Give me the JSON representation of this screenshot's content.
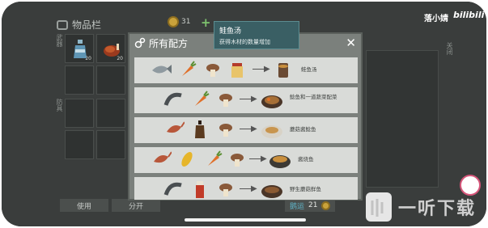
{
  "inventory": {
    "title": "物品栏",
    "coins": "31",
    "section_label": "武器",
    "section_label_2": "防具"
  },
  "inventory_items": [
    {
      "count": "20",
      "icon": "bottle-icon"
    },
    {
      "count": "20",
      "icon": "roast-chicken-icon"
    }
  ],
  "bottom_buttons": {
    "use": "使用",
    "split": "分开"
  },
  "right_panel": {
    "label": "关闭"
  },
  "stat": {
    "label": "鹅运",
    "value": "21"
  },
  "panel": {
    "title": "所有配方",
    "close": "✕"
  },
  "tooltip": {
    "title": "鲑鱼汤",
    "description": "获得木材的数量增加"
  },
  "recipes": [
    {
      "ingredients": [
        "fish-icon",
        "carrot-icon",
        "mushroom-icon",
        "jar-icon"
      ],
      "result_icon": "soup-bowl-icon",
      "name": "鲑鱼汤"
    },
    {
      "ingredients": [
        "eel-icon",
        "carrot-icon",
        "mushroom-icon"
      ],
      "result_icon": "stew-plate-icon",
      "name": "鲶鱼和一道蔬菜配菜"
    },
    {
      "ingredients": [
        "shrimp-icon",
        "bottle-icon",
        "mushroom-icon"
      ],
      "result_icon": "shrimp-plate-icon",
      "name": "蘑菇酱鲶鱼"
    },
    {
      "ingredients": [
        "shrimp-icon",
        "corn-icon",
        "carrot-icon",
        "mushroom-icon"
      ],
      "result_icon": "fish-plate-icon",
      "name": "酱烧鱼"
    },
    {
      "ingredients": [
        "eel-icon",
        "sauce-icon",
        "mushroom-icon"
      ],
      "result_icon": "grill-plate-icon",
      "name": "野生蘑菇鲜鱼"
    }
  ],
  "watermark": {
    "user": "落小婧",
    "brand": "bilibili",
    "logo_text": "一听下载"
  },
  "colors": {
    "panel_bg": "#7b807c",
    "row_bg": "#d9dbd8",
    "tooltip_bg": "#3a5f64",
    "accent": "#5fb4c8"
  }
}
